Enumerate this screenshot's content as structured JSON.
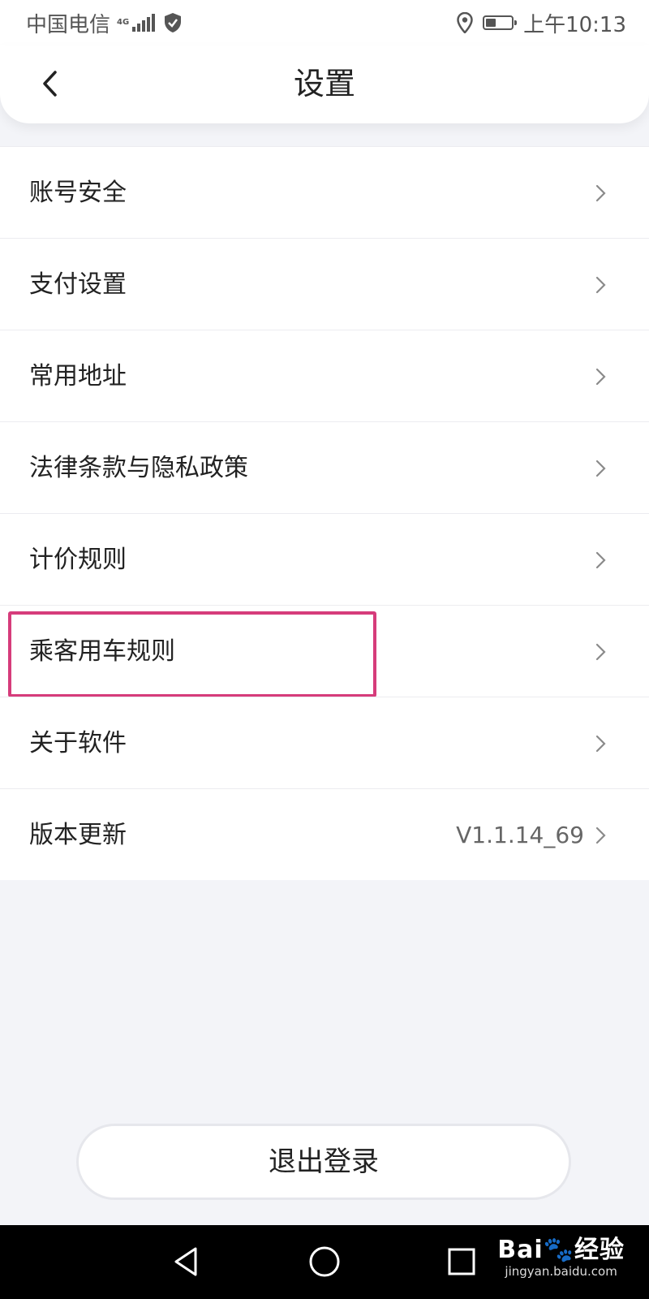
{
  "status_bar": {
    "carrier": "中国电信",
    "network": "4G",
    "time": "上午10:13",
    "icons": [
      "signal-icon",
      "shield-icon",
      "location-icon",
      "battery-icon"
    ]
  },
  "header": {
    "title": "设置",
    "back_icon": "chevron-left-icon"
  },
  "settings": {
    "items": [
      {
        "label": "账号安全",
        "value": ""
      },
      {
        "label": "支付设置",
        "value": ""
      },
      {
        "label": "常用地址",
        "value": ""
      },
      {
        "label": "法律条款与隐私政策",
        "value": ""
      },
      {
        "label": "计价规则",
        "value": ""
      },
      {
        "label": "乘客用车规则",
        "value": "",
        "highlighted": true
      },
      {
        "label": "关于软件",
        "value": ""
      },
      {
        "label": "版本更新",
        "value": "V1.1.14_69"
      }
    ]
  },
  "logout": {
    "label": "退出登录"
  },
  "nav_bar": {
    "buttons": [
      "back-triangle-icon",
      "home-circle-icon",
      "recents-square-icon"
    ]
  },
  "watermark": {
    "main": "Bai🐾经验",
    "sub": "jingyan.baidu.com"
  },
  "colors": {
    "highlight": "#d63c7b",
    "background": "#f3f4f8",
    "nav_bar": "#000000"
  }
}
